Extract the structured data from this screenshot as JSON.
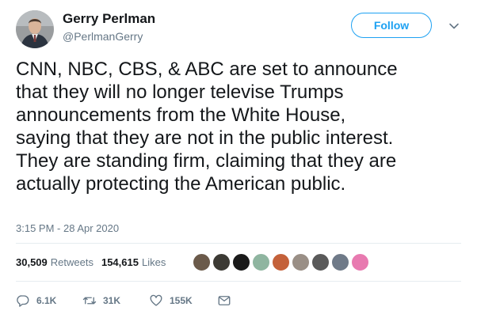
{
  "author": {
    "name": "Gerry Perlman",
    "handle": "@PerlmanGerry"
  },
  "follow_label": "Follow",
  "tweet_lines": [
    "CNN, NBC, CBS, & ABC are set to announce",
    "that they will no longer televise Trumps",
    "announcements from the White House,",
    "saying that they are not in the public interest.",
    "They are standing firm, claiming that they are",
    "actually protecting the American public."
  ],
  "timestamp": "3:15 PM - 28 Apr 2020",
  "stats": {
    "retweets_count": "30,509",
    "retweets_label": "Retweets",
    "likes_count": "154,615",
    "likes_label": "Likes"
  },
  "liker_avatar_colors": [
    "#6b5a4a",
    "#3c3a34",
    "#1a1a1a",
    "#8fb5a0",
    "#c4613a",
    "#9a8f86",
    "#5a5a5a",
    "#6f7a88",
    "#e87ab0"
  ],
  "actions": {
    "reply_count": "6.1K",
    "retweet_count": "31K",
    "like_count": "155K"
  },
  "icons": {
    "reply": "reply-icon",
    "retweet": "retweet-icon",
    "like": "like-icon",
    "dm": "envelope-icon",
    "menu": "chevron-down-icon"
  },
  "colors": {
    "accent": "#1da1f2",
    "secondary_text": "#657786",
    "divider": "#e6ecf0"
  }
}
